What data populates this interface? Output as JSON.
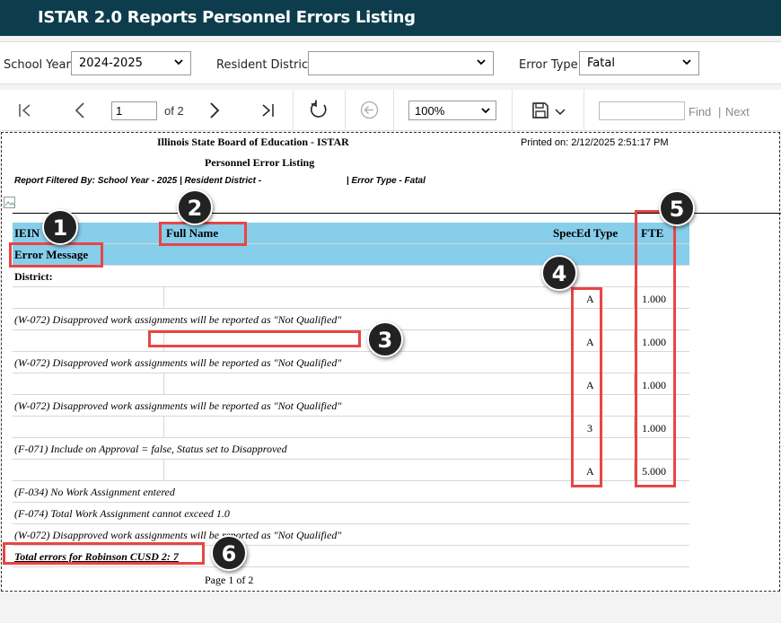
{
  "app": {
    "title": "ISTAR 2.0 Reports Personnel Errors Listing"
  },
  "filters": {
    "school_year_label": "School Year",
    "school_year_value": "2024-2025",
    "resident_district_label": "Resident District",
    "resident_district_value": "",
    "error_type_label": "Error Type",
    "error_type_value": "Fatal"
  },
  "toolbar": {
    "page_value": "1",
    "page_of": "of 2",
    "zoom_value": "100%",
    "find_label": "Find",
    "sep": "|",
    "next_label": "Next"
  },
  "report": {
    "org": "Illinois State Board of Education - ISTAR",
    "title": "Personnel Error Listing",
    "printed": "Printed on: 2/12/2025 2:51:17 PM",
    "filtered_by": "Report Filtered By: School Year - 2025 | Resident District -",
    "filtered_error_type": "| Error Type - Fatal",
    "columns": {
      "iein": "IEIN",
      "full_name": "Full Name",
      "sped_type": "SpecEd Type",
      "fte": "FTE"
    },
    "error_message_header": "Error Message",
    "district_label": "District:",
    "records": [
      {
        "sped": "A",
        "fte": "1.000",
        "messages": [
          "(W-072) Disapproved work assignments will be reported as \"Not Qualified\""
        ]
      },
      {
        "sped": "A",
        "fte": "1.000",
        "messages": [
          "(W-072) Disapproved work assignments will be reported as \"Not Qualified\""
        ]
      },
      {
        "sped": "A",
        "fte": "1.000",
        "messages": [
          "(W-072) Disapproved work assignments will be reported as \"Not Qualified\""
        ]
      },
      {
        "sped": "3",
        "fte": "1.000",
        "messages": [
          "(F-071) Include on Approval = false, Status set to Disapproved"
        ]
      },
      {
        "sped": "A",
        "fte": "5.000",
        "messages": [
          "(F-034) No Work Assignment entered",
          "(F-074) Total Work Assignment cannot exceed 1.0",
          "(W-072) Disapproved work assignments will be reported as \"Not Qualified\""
        ]
      }
    ],
    "total": "Total errors for Robinson CUSD 2: 7",
    "page_footer": "Page 1 of 2"
  },
  "callouts": [
    "1",
    "2",
    "3",
    "4",
    "5",
    "6"
  ],
  "colors": {
    "titlebar": "#0d3d4d",
    "table_header": "#87ceeb",
    "highlight": "#e84545",
    "badge": "#222222"
  }
}
